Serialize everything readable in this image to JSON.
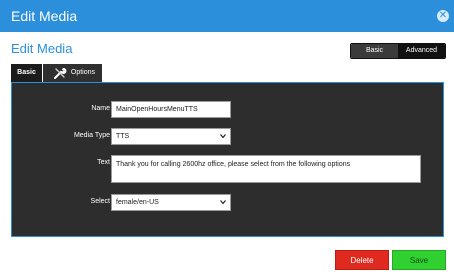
{
  "dialog": {
    "title": "Edit Media",
    "close_icon": "close-icon",
    "subtitle": "Edit Media"
  },
  "mode_toggle": {
    "basic_label": "Basic",
    "advanced_label": "Advanced",
    "active": "Advanced"
  },
  "tabs": [
    {
      "label": "Basic",
      "active": true
    },
    {
      "label": "Options",
      "icon": "wrench-icon",
      "active": false
    }
  ],
  "form": {
    "name": {
      "label": "Name",
      "value": "MainOpenHoursMenuTTS"
    },
    "media_type": {
      "label": "Media Type",
      "value": "TTS"
    },
    "text": {
      "label": "Text",
      "value": "Thank you for calling 2600hz office, please select from the following options"
    },
    "select": {
      "label": "Select",
      "value": "female/en-US"
    }
  },
  "actions": {
    "delete_label": "Delete",
    "save_label": "Save"
  },
  "colors": {
    "accent": "#2b8fdc",
    "panel": "#2d2d2d",
    "delete": "#e0291f",
    "save": "#2fd02f"
  }
}
